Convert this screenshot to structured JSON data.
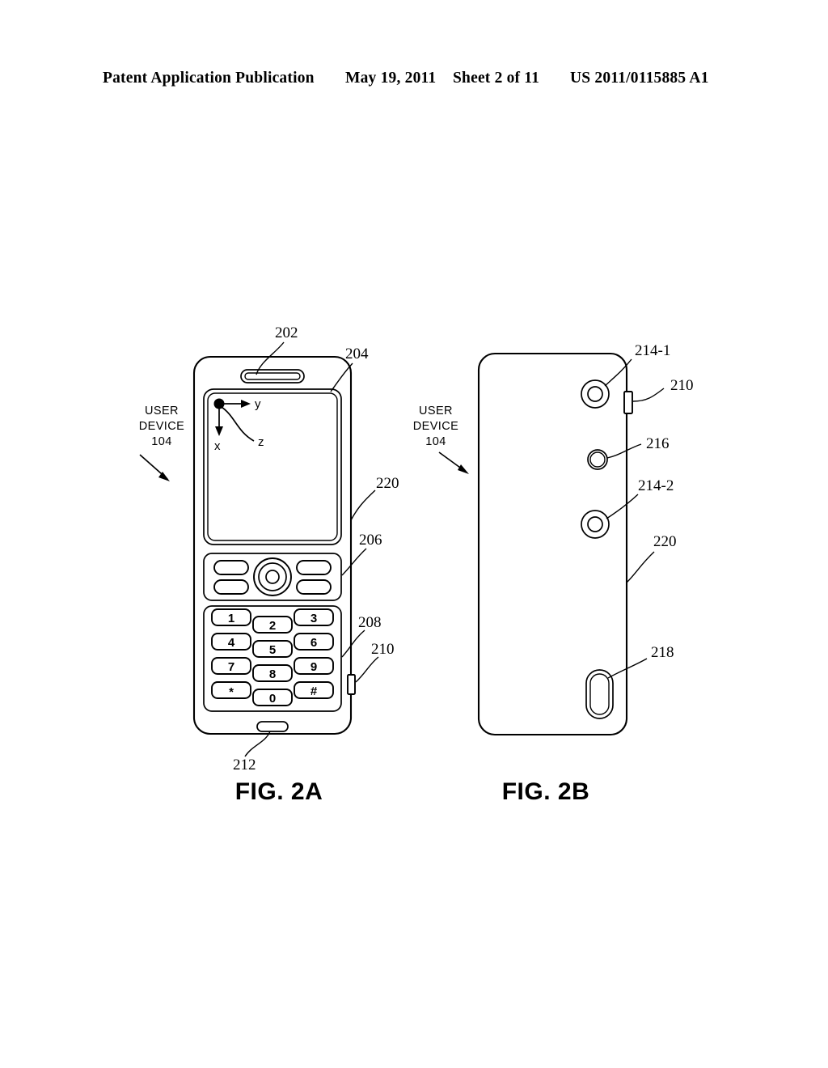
{
  "header": {
    "publication": "Patent Application Publication",
    "date": "May 19, 2011",
    "sheet": "Sheet 2 of 11",
    "patent_number": "US 2011/0115885 A1"
  },
  "figures": [
    {
      "id": "fig-2a",
      "caption": "FIG. 2A",
      "device_label": {
        "line1": "USER",
        "line2": "DEVICE",
        "line3": "104"
      },
      "axes": {
        "x": "x",
        "y": "y",
        "z": "z"
      },
      "keypad": {
        "keys": [
          "1",
          "2",
          "3",
          "4",
          "5",
          "6",
          "7",
          "8",
          "9",
          "*",
          "0",
          "#"
        ]
      },
      "callouts": [
        {
          "ref": "202",
          "target": "speaker"
        },
        {
          "ref": "204",
          "target": "display"
        },
        {
          "ref": "220",
          "target": "housing"
        },
        {
          "ref": "206",
          "target": "control-keys"
        },
        {
          "ref": "208",
          "target": "keypad"
        },
        {
          "ref": "210",
          "target": "side-button"
        },
        {
          "ref": "212",
          "target": "microphone"
        }
      ]
    },
    {
      "id": "fig-2b",
      "caption": "FIG. 2B",
      "device_label": {
        "line1": "USER",
        "line2": "DEVICE",
        "line3": "104"
      },
      "callouts": [
        {
          "ref": "214-1",
          "target": "sensor-upper"
        },
        {
          "ref": "210",
          "target": "side-button"
        },
        {
          "ref": "216",
          "target": "camera"
        },
        {
          "ref": "214-2",
          "target": "sensor-lower"
        },
        {
          "ref": "220",
          "target": "housing"
        },
        {
          "ref": "218",
          "target": "connector"
        }
      ]
    }
  ],
  "colors": {
    "ink": "#000000",
    "page": "#ffffff"
  }
}
